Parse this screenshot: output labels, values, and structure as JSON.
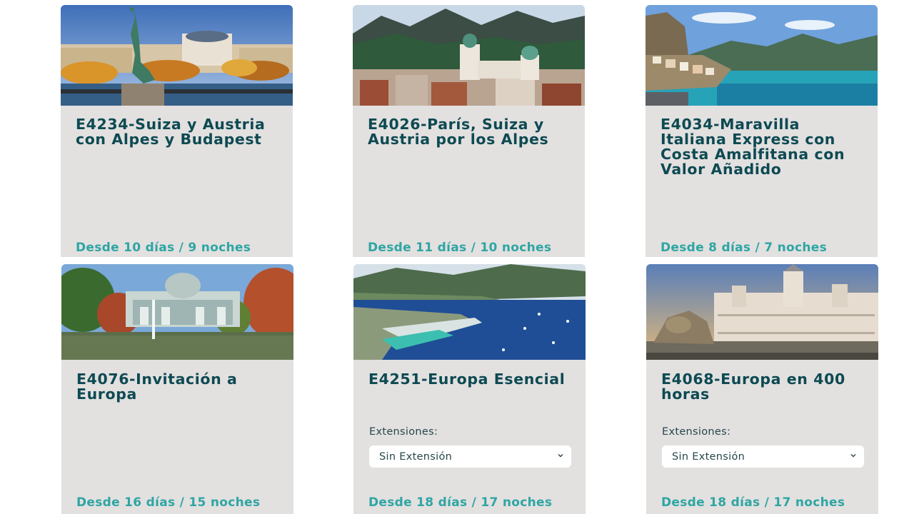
{
  "tours": [
    {
      "title": "E4234-Suiza y Austria con Alpes y Budapest",
      "duration": "Desde 10 días / 9 noches",
      "image_icon": "lakeside-statue-photo"
    },
    {
      "title": "E4026-París, Suiza y Austria por los Alpes",
      "duration": "Desde 11 días / 10 noches",
      "image_icon": "alpine-town-photo"
    },
    {
      "title": "E4034-Maravilla Italiana Express con Costa Amalfitana con Valor Añadido",
      "duration": "Desde 8 días / 7 noches",
      "image_icon": "amalfi-coast-photo"
    },
    {
      "title": "E4076-Invitación a Europa",
      "duration": "Desde 16 días / 15 noches",
      "image_icon": "crystal-palace-photo"
    },
    {
      "title": "E4251-Europa Esencial",
      "duration": "Desde 18 días / 17 noches",
      "extensions_label": "Extensiones:",
      "extension_selected": "Sin Extensión",
      "image_icon": "harbor-bay-photo"
    },
    {
      "title": "E4068-Europa en 400 horas",
      "duration": "Desde 18 días / 17 noches",
      "extensions_label": "Extensiones:",
      "extension_selected": "Sin Extensión",
      "image_icon": "cibeles-palace-photo"
    }
  ],
  "colors": {
    "title": "#0d4a52",
    "duration": "#2ea6a3",
    "card_bg": "#e3e0e0"
  }
}
